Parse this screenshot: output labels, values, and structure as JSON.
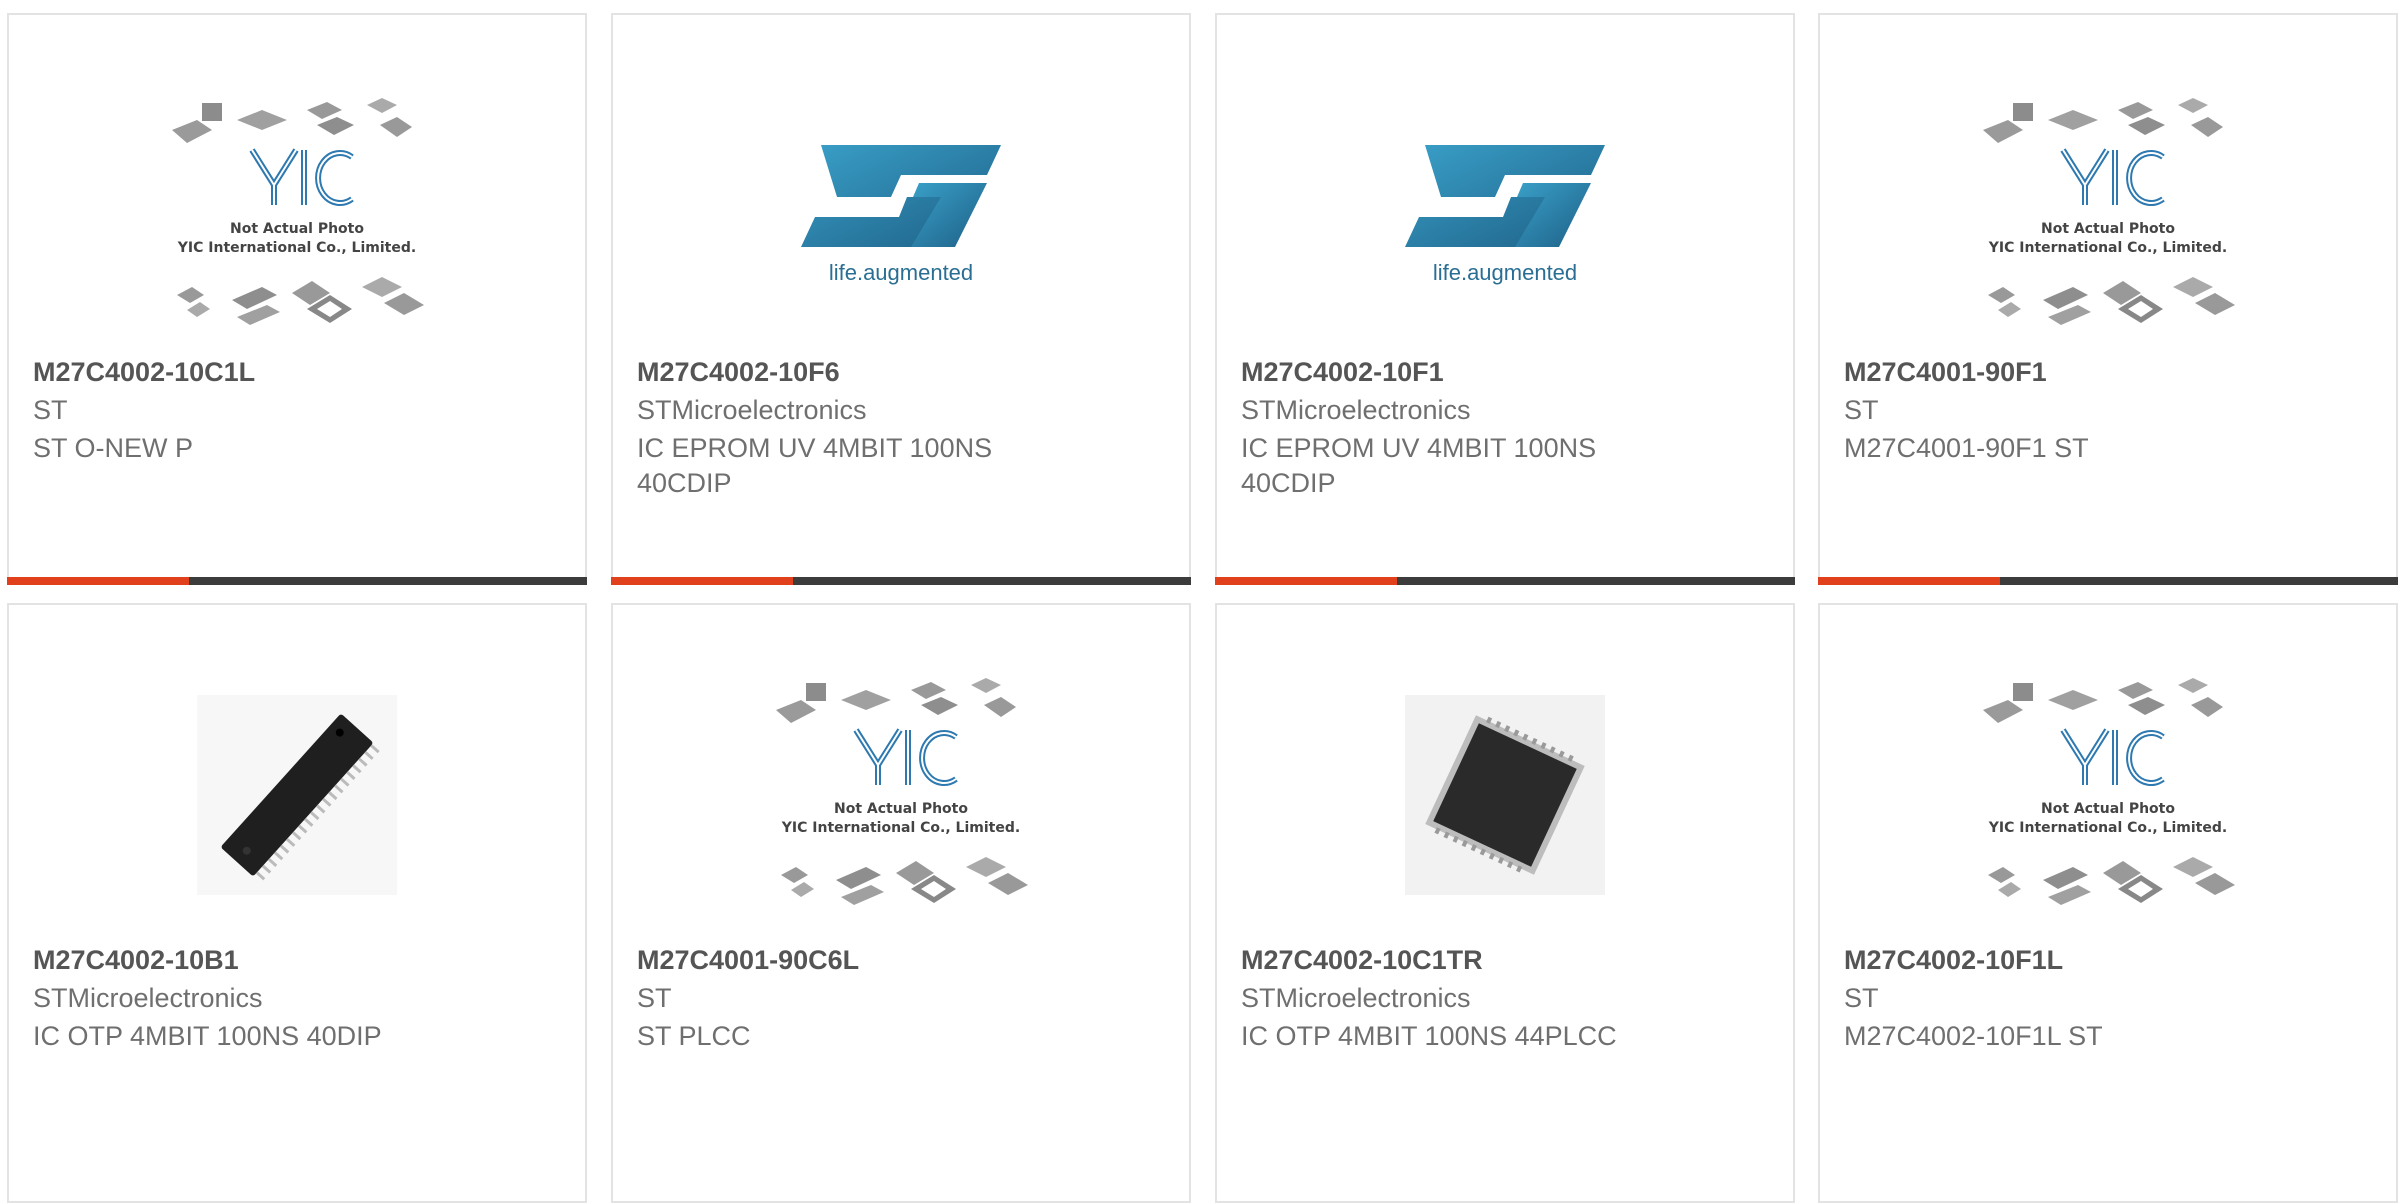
{
  "products": [
    {
      "part_number": "M27C4002-10C1L",
      "manufacturer": "ST",
      "description": "ST O-NEW P",
      "image": "yic-placeholder-image",
      "placeholder_caption": [
        "Not Actual Photo",
        "YIC International Co., Limited."
      ]
    },
    {
      "part_number": "M27C4002-10F6",
      "manufacturer": "STMicroelectronics",
      "description": "IC EPROM UV 4MBIT 100NS 40CDIP",
      "image": "st-logo",
      "logo_tagline": "life.augmented"
    },
    {
      "part_number": "M27C4002-10F1",
      "manufacturer": "STMicroelectronics",
      "description": "IC EPROM UV 4MBIT 100NS 40CDIP",
      "image": "st-logo",
      "logo_tagline": "life.augmented"
    },
    {
      "part_number": "M27C4001-90F1",
      "manufacturer": "ST",
      "description": "M27C4001-90F1 ST",
      "image": "yic-placeholder-image",
      "placeholder_caption": [
        "Not Actual Photo",
        "YIC International Co., Limited."
      ]
    },
    {
      "part_number": "M27C4002-10B1",
      "manufacturer": "STMicroelectronics",
      "description": "IC OTP 4MBIT 100NS 40DIP",
      "image": "dip-chip-photo"
    },
    {
      "part_number": "M27C4001-90C6L",
      "manufacturer": "ST",
      "description": "ST PLCC",
      "image": "yic-placeholder-image",
      "placeholder_caption": [
        "Not Actual Photo",
        "YIC International Co., Limited."
      ]
    },
    {
      "part_number": "M27C4002-10C1TR",
      "manufacturer": "STMicroelectronics",
      "description": "IC OTP 4MBIT 100NS 44PLCC",
      "image": "plcc-chip-photo"
    },
    {
      "part_number": "M27C4002-10F1L",
      "manufacturer": "ST",
      "description": "M27C4002-10F1L ST",
      "image": "yic-placeholder-image",
      "placeholder_caption": [
        "Not Actual Photo",
        "YIC International Co., Limited."
      ]
    }
  ],
  "colors": {
    "accent_bar": "#e0401c",
    "dark_bar": "#3c3c3c",
    "st_logo_blue": "#2a86b3"
  }
}
